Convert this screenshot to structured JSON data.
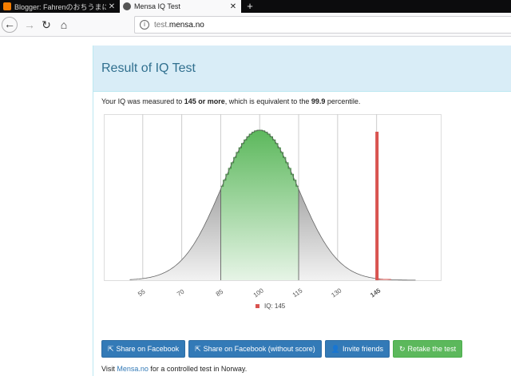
{
  "browser": {
    "tabs": [
      {
        "title": "Blogger: Fahrenのおちうまに - B",
        "active": false
      },
      {
        "title": "Mensa IQ Test",
        "active": true
      }
    ],
    "new_tab_symbol": "+",
    "url_host": "test.",
    "url_domain": "mensa.no"
  },
  "page": {
    "heading": "Result of IQ Test",
    "result_prefix": "Your IQ was measured to ",
    "result_score": "145 or more",
    "result_mid": ", which is equivalent to the ",
    "result_percentile": "99.9",
    "result_suffix": " percentile.",
    "buttons": {
      "share_facebook": "Share on Facebook",
      "share_facebook_anon": "Share on Facebook (without score)",
      "invite_friends": "Invite friends",
      "retake": "Retake the test"
    },
    "visit_prefix": "Visit ",
    "visit_link": "Mensa.no",
    "visit_suffix": " for a controlled test in Norway."
  },
  "chart_data": {
    "type": "area",
    "description_free": true,
    "distribution": {
      "mean": 100,
      "sd": 15
    },
    "x_range": [
      40,
      170
    ],
    "x_ticks": [
      55,
      70,
      85,
      100,
      115,
      130,
      145
    ],
    "highlight_range": [
      85,
      115
    ],
    "user_iq": 145,
    "legend": "IQ: 145",
    "colors": {
      "tail_fill": "#d4d4d4",
      "center_fill": "#5cb85c",
      "marker": "#d9534f",
      "grid": "#cccccc"
    }
  }
}
